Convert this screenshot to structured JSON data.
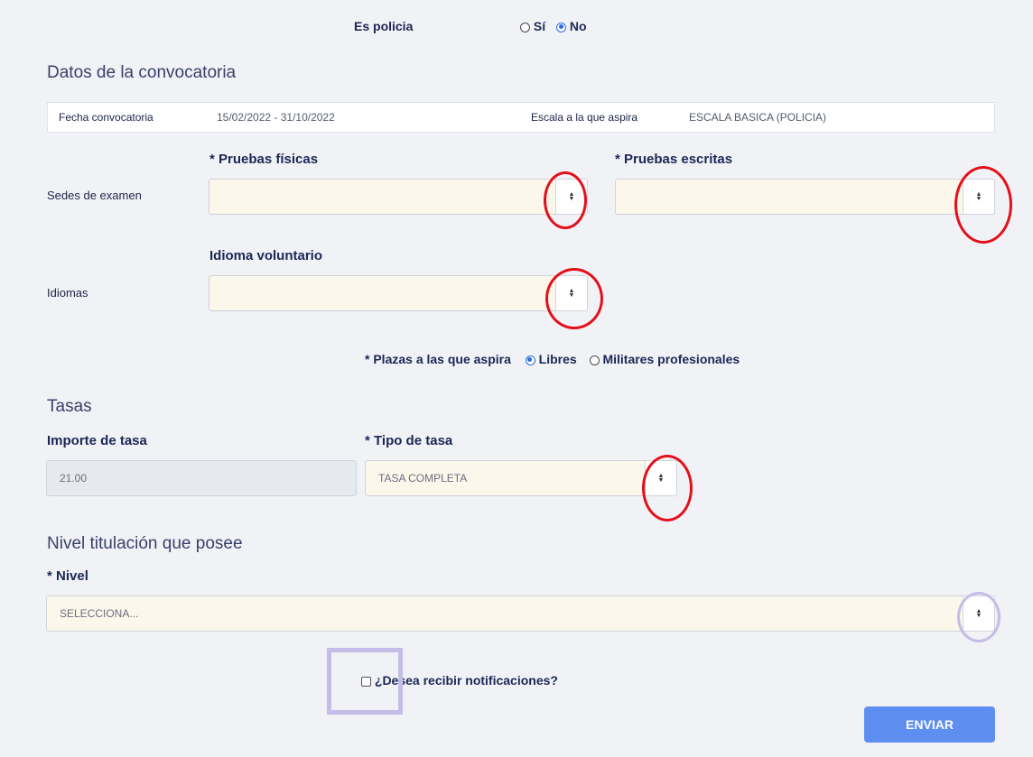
{
  "policia": {
    "label": "Es policia",
    "options": [
      "Sí",
      "No"
    ],
    "selected": "No"
  },
  "convocatoria": {
    "title": "Datos de la convocatoria",
    "fecha_label": "Fecha convocatoria",
    "fecha_value": "15/02/2022 - 31/10/2022",
    "escala_label": "Escala a la que aspira",
    "escala_value": "ESCALA BASICA (POLICIA)"
  },
  "sedes": {
    "row_label": "Sedes de examen",
    "fisicas_label": "* Pruebas físicas",
    "fisicas_value": "",
    "escritas_label": "* Pruebas escritas",
    "escritas_value": ""
  },
  "idiomas": {
    "row_label": "Idiomas",
    "field_label": "Idioma voluntario",
    "value": ""
  },
  "plazas": {
    "label": "* Plazas a las que aspira",
    "options": [
      "Libres",
      "Militares profesionales"
    ],
    "selected": "Libres"
  },
  "tasas": {
    "title": "Tasas",
    "importe_label": "Importe de tasa",
    "importe_value": "21.00",
    "tipo_label": "* Tipo de tasa",
    "tipo_value": "TASA COMPLETA"
  },
  "titulacion": {
    "title": "Nivel titulación que posee",
    "nivel_label": "* Nivel",
    "nivel_value": "SELECCIONA..."
  },
  "notificaciones": {
    "label": "¿Desea recibir notificaciones?",
    "checked": false
  },
  "submit_label": "ENVIAR",
  "icons": {
    "select_arrow": "sort-arrows-icon"
  },
  "colors": {
    "primary_button": "#5d8ef0",
    "select_bg": "#fbf7ea",
    "annotation_red": "#e3101a",
    "annotation_purple": "#c5bde7"
  }
}
